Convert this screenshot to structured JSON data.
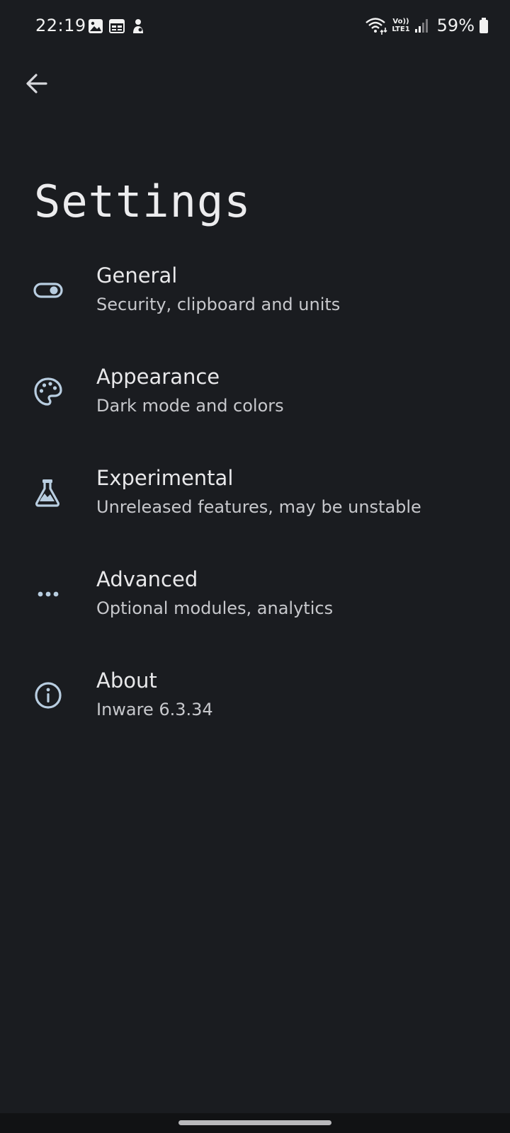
{
  "status_bar": {
    "time": "22:19",
    "battery": "59%",
    "network_label_top": "Vo))",
    "network_label_bottom": "LTE1",
    "left_icons": [
      "gallery-icon",
      "calendar-icon",
      "person-icon"
    ],
    "right_icons": [
      "wifi-icon",
      "volte-icon",
      "signal-icon",
      "battery-icon"
    ]
  },
  "header": {
    "back_icon": "arrow-back-icon",
    "title": "Settings"
  },
  "settings": {
    "items": [
      {
        "icon": "toggle-icon",
        "title": "General",
        "subtitle": "Security, clipboard and units"
      },
      {
        "icon": "palette-icon",
        "title": "Appearance",
        "subtitle": "Dark mode and colors"
      },
      {
        "icon": "flask-icon",
        "title": "Experimental",
        "subtitle": "Unreleased features, may be unstable"
      },
      {
        "icon": "more-horizontal-icon",
        "title": "Advanced",
        "subtitle": "Optional modules, analytics"
      },
      {
        "icon": "info-icon",
        "title": "About",
        "subtitle": "Inware 6.3.34"
      }
    ]
  },
  "colors": {
    "background": "#1a1c20",
    "icon_tint": "#b8cde0",
    "title_text": "#e8e8ea",
    "subtitle_text": "#c7c8cc"
  }
}
